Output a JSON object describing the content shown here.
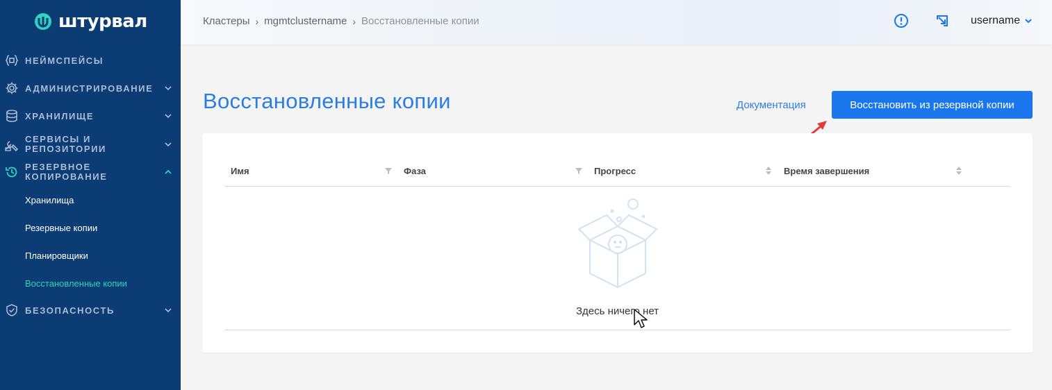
{
  "brand": {
    "name": "штурвал"
  },
  "sidebar": {
    "items": [
      {
        "label": "Неймспейсы",
        "icon": "braces-icon"
      },
      {
        "label": "Администрирование",
        "icon": "gear-icon"
      },
      {
        "label": "Хранилище",
        "icon": "database-icon"
      },
      {
        "label_line1": "Сервисы и",
        "label_line2": "репозитории",
        "icon": "tools-icon"
      },
      {
        "label_line1": "Резервное",
        "label_line2": "копирование",
        "icon": "history-icon"
      },
      {
        "label": "Безопасность",
        "icon": "shield-icon"
      }
    ],
    "backup_submenu": [
      "Хранилища",
      "Резервные копии",
      "Планировщики",
      "Восстановленные копии"
    ]
  },
  "header": {
    "breadcrumb": [
      "Кластеры",
      "mgmtclustername",
      "Восстановленные копии"
    ],
    "username": "username"
  },
  "main": {
    "title": "Восстановленные копии",
    "doc_link": "Документация",
    "restore_button": "Восстановить из резервной копии",
    "table": {
      "columns": [
        "Имя",
        "Фаза",
        "Прогресс",
        "Время завершения"
      ],
      "rows": [],
      "empty_text": "Здесь ничего нет"
    }
  },
  "colors": {
    "sidebar_bg": "#0b3c73",
    "accent": "#1976ec",
    "title": "#2b7de2",
    "active_sub": "#2fd3c4",
    "annotation_arrow": "#e03a3a"
  }
}
